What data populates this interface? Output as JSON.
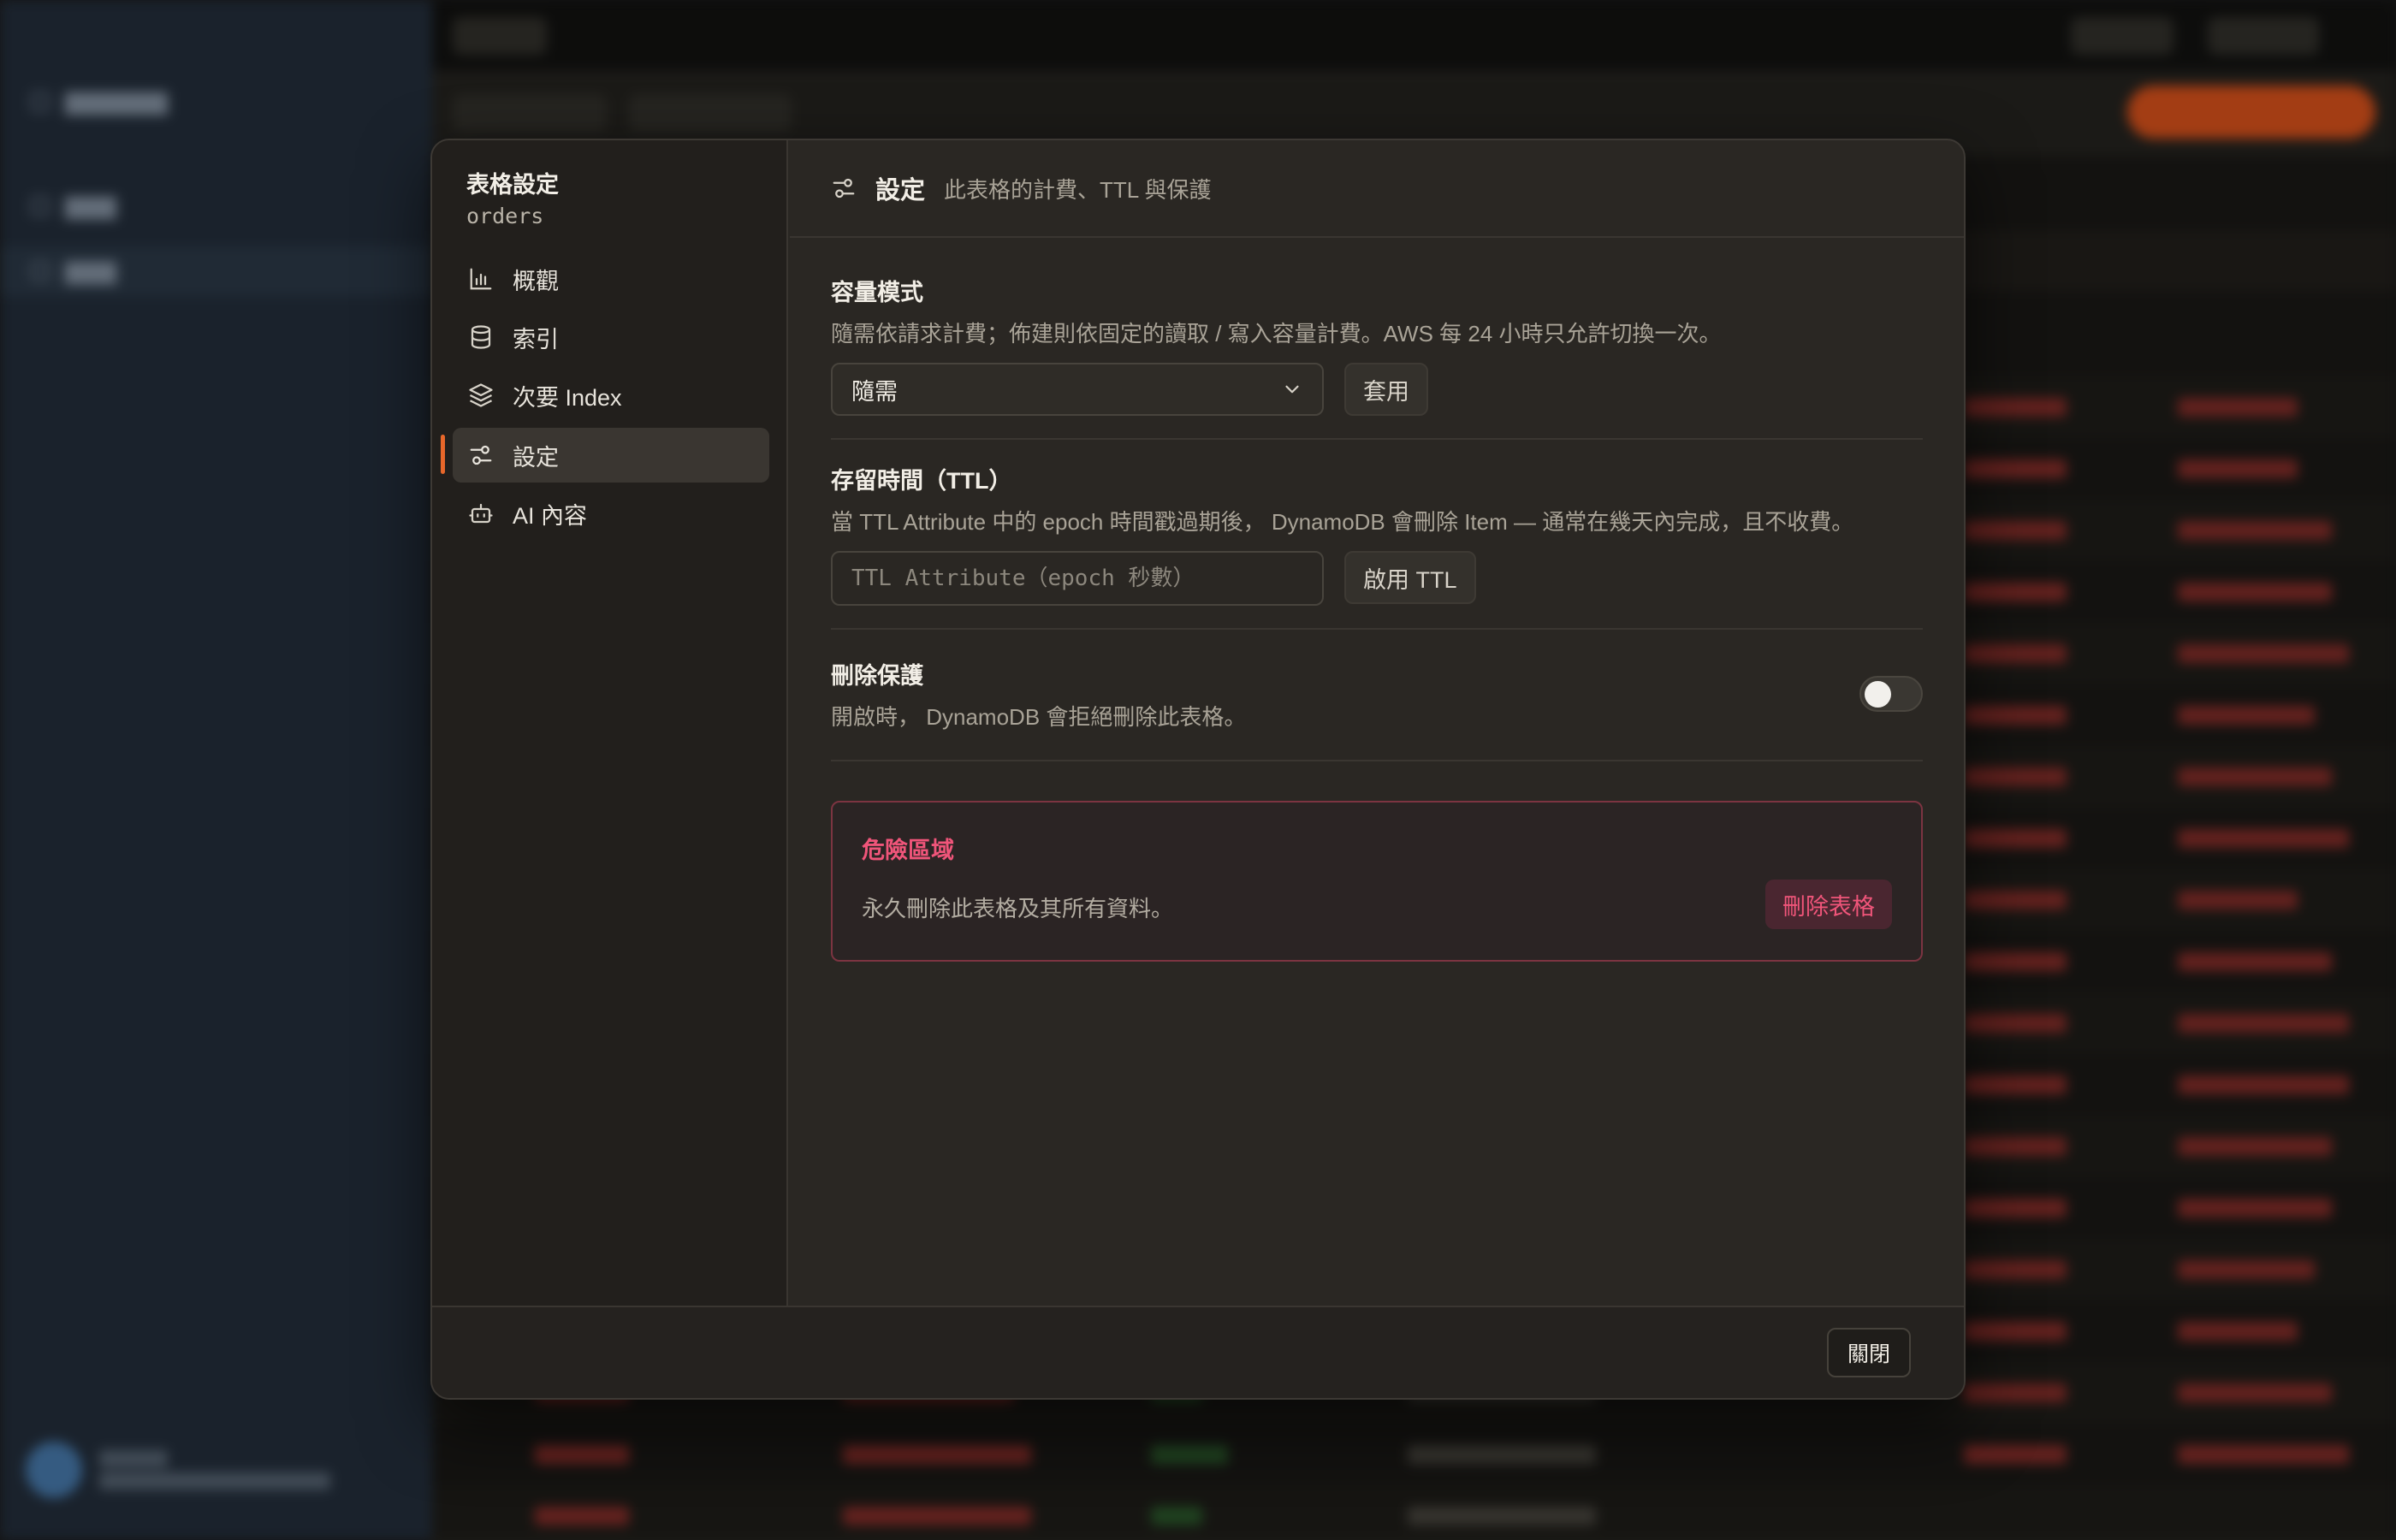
{
  "modal": {
    "title": "表格設定",
    "table_name": "orders",
    "nav": [
      {
        "label": "概觀",
        "icon": "bar-chart-icon"
      },
      {
        "label": "索引",
        "icon": "database-icon"
      },
      {
        "label": "次要 Index",
        "icon": "layers-icon"
      },
      {
        "label": "設定",
        "icon": "sliders-icon",
        "active": true
      },
      {
        "label": "AI 內容",
        "icon": "bot-icon"
      }
    ],
    "header": {
      "title": "設定",
      "description": "此表格的計費、TTL 與保護"
    },
    "capacity": {
      "title": "容量模式",
      "description": "隨需依請求計費；佈建則依固定的讀取 / 寫入容量計費。AWS 每 24 小時只允許切換一次。",
      "selected": "隨需",
      "apply_label": "套用"
    },
    "ttl": {
      "title": "存留時間（TTL）",
      "description": "當 TTL Attribute 中的 epoch 時間戳過期後， DynamoDB 會刪除 Item — 通常在幾天內完成，且不收費。",
      "placeholder": "TTL Attribute（epoch 秒數）",
      "enable_label": "啟用 TTL"
    },
    "deletion_protection": {
      "title": "刪除保護",
      "description": "開啟時， DynamoDB 會拒絕刪除此表格。",
      "enabled": false
    },
    "danger_zone": {
      "title": "危險區域",
      "description": "永久刪除此表格及其所有資料。",
      "delete_label": "刪除表格"
    },
    "close_label": "關閉"
  },
  "colors": {
    "accent": "#e8672a",
    "danger": "#f0557a",
    "modal_bg": "#2a2723"
  }
}
